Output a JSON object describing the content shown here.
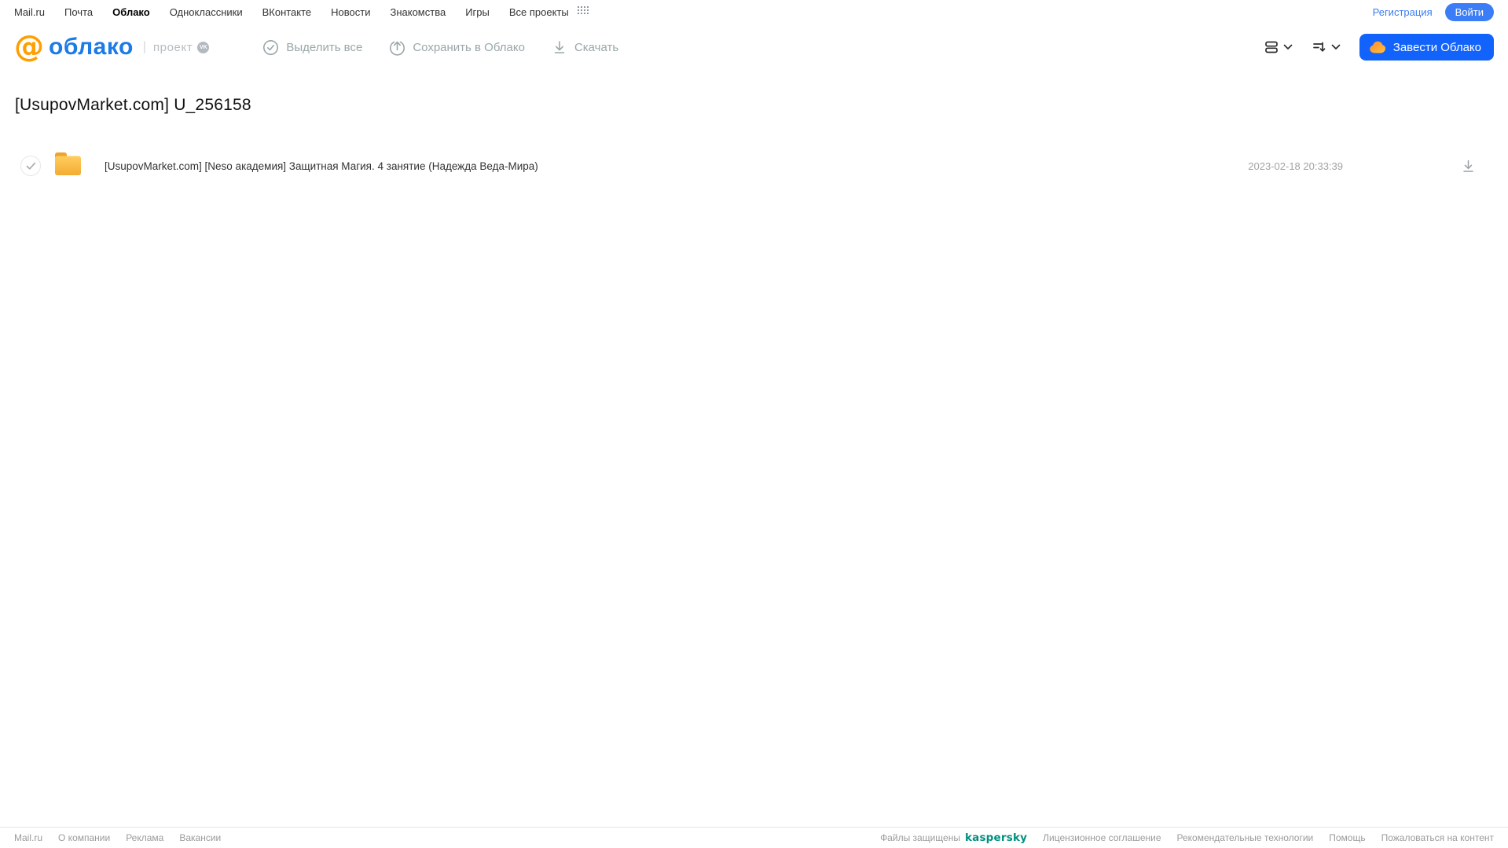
{
  "portal_nav": {
    "links": [
      "Mail.ru",
      "Почта",
      "Облако",
      "Одноклассники",
      "ВКонтакте",
      "Новости",
      "Знакомства",
      "Игры",
      "Все проекты"
    ],
    "active_link": "Облако",
    "registration_label": "Регистрация",
    "login_label": "Войти"
  },
  "header": {
    "logo_at": "@",
    "logo_word": "облако",
    "project_label": "проект",
    "vk_badge": "VK",
    "toolbar": {
      "select_all_label": "Выделить все",
      "save_to_cloud_label": "Сохранить в Облако",
      "download_label": "Скачать"
    },
    "get_cloud_label": "Завести Облако"
  },
  "page": {
    "title": "[UsupovMarket.com] U_256158"
  },
  "files": [
    {
      "name": "[UsupovMarket.com] [Neso академия] Защитная Магия. 4 занятие (Надежда Веда-Мира)",
      "modified": "2023-02-18 20:33:39",
      "type": "folder"
    }
  ],
  "footer": {
    "left_links": [
      "Mail.ru",
      "О компании",
      "Реклама",
      "Вакансии"
    ],
    "protected_label": "Файлы защищены",
    "kaspersky_logo": "kaspersky",
    "right_links": [
      "Лицензионное соглашение",
      "Рекомендательные технологии",
      "Помощь",
      "Пожаловаться на контент"
    ]
  },
  "colors": {
    "accent_blue": "#1263fb",
    "login_blue": "#3b7df6",
    "logo_blue": "#1d7be5",
    "logo_orange": "#ff9e00",
    "folder_yellow": "#f7b733",
    "kaspersky_green": "#008f7f",
    "muted_toolbar": "#9ba6a9"
  }
}
